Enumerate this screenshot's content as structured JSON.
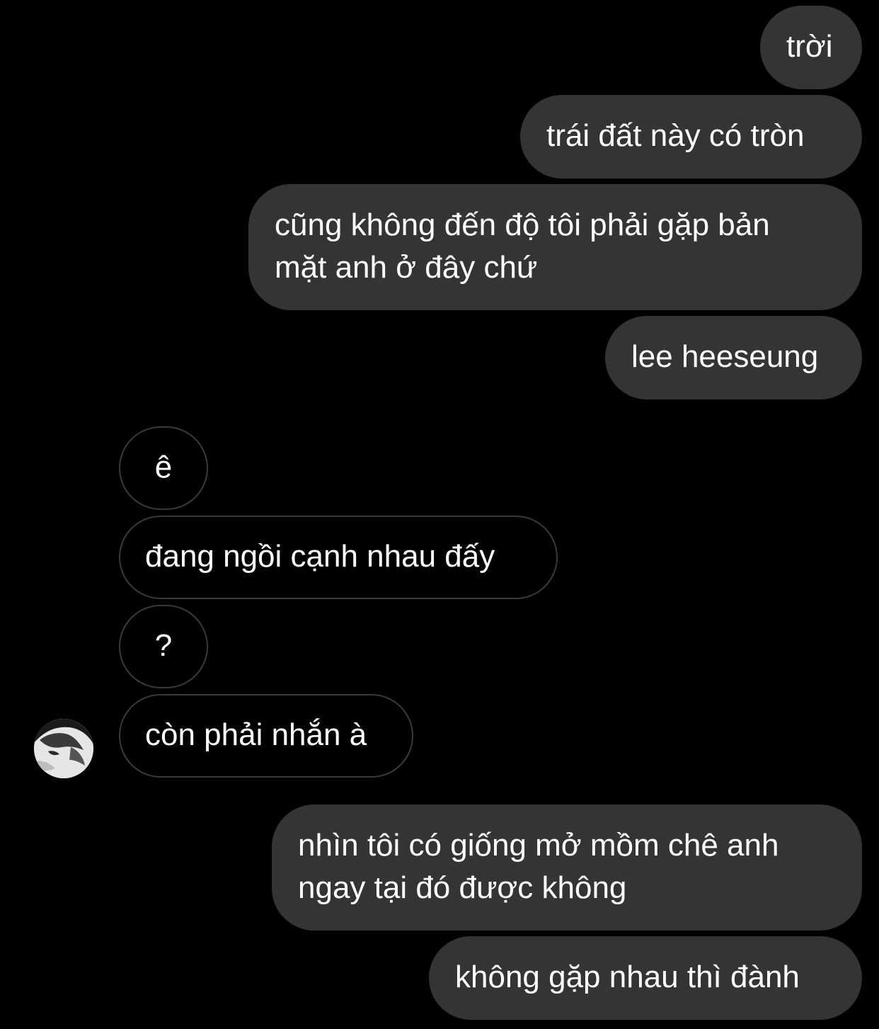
{
  "conversation": {
    "messages": [
      {
        "sender": "me",
        "text": "trời"
      },
      {
        "sender": "me",
        "text": "trái đất này có tròn"
      },
      {
        "sender": "me",
        "lines": [
          "cũng không đến độ tôi phải gặp bản",
          "mặt anh ở đây chứ"
        ]
      },
      {
        "sender": "me",
        "text": "lee heeseung"
      },
      {
        "sender": "them",
        "text": "ê"
      },
      {
        "sender": "them",
        "text": "đang ngồi cạnh nhau đấy"
      },
      {
        "sender": "them",
        "text": "?"
      },
      {
        "sender": "them",
        "text": "còn phải nhắn à"
      },
      {
        "sender": "me",
        "lines": [
          "nhìn tôi có giống mở mồm chê anh",
          "ngay tại đó được không"
        ]
      },
      {
        "sender": "me",
        "text": "không gặp nhau thì đành"
      }
    ]
  },
  "colors": {
    "background": "#000000",
    "outgoing_bubble": "#343434",
    "incoming_border": "#3a3a3a",
    "text": "#ffffff"
  },
  "icons": {
    "avatar": "contact-avatar-photo"
  }
}
